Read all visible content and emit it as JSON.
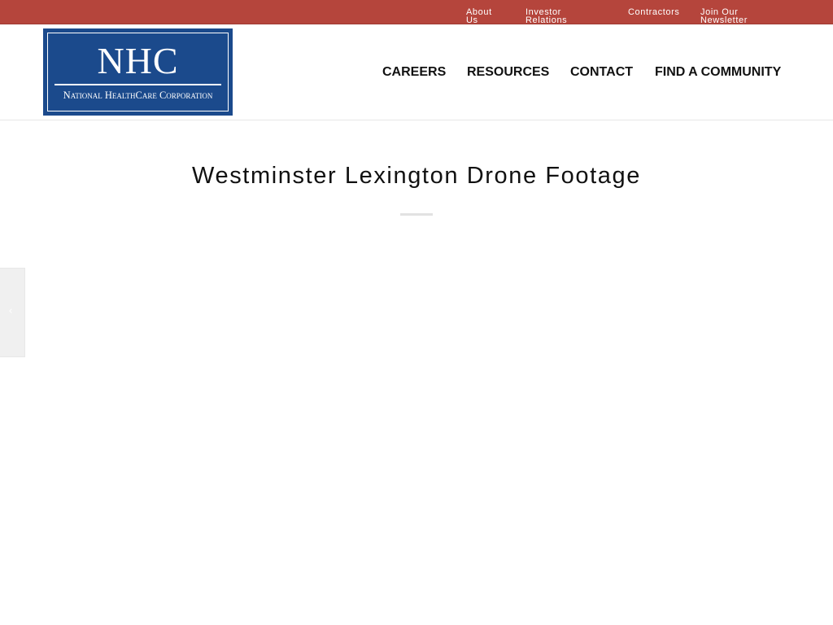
{
  "topbar": {
    "links": [
      {
        "label": "About Us"
      },
      {
        "label": "Investor Relations"
      },
      {
        "label": "Contractors"
      },
      {
        "label": "Join Our Newsletter"
      }
    ]
  },
  "logo": {
    "mark": "NHC",
    "subtitle": "National HealthCare Corporation"
  },
  "nav": {
    "items": [
      {
        "label": "CAREERS"
      },
      {
        "label": "RESOURCES"
      },
      {
        "label": "CONTACT"
      },
      {
        "label": "FIND A COMMUNITY"
      }
    ]
  },
  "page": {
    "title": "Westminster Lexington Drone Footage"
  },
  "side_nav": {
    "prev_icon": "chevron-left-icon"
  },
  "colors": {
    "topbar": "#b5453c",
    "logo_blue": "#1b4a8c",
    "nav_text": "#111111"
  }
}
